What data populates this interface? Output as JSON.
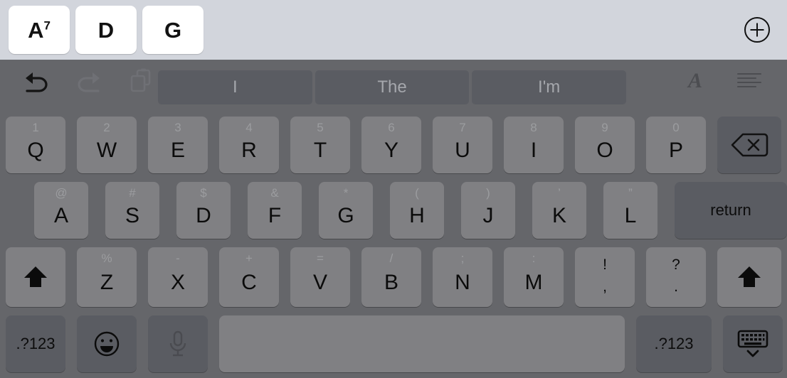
{
  "topbar": {
    "chords": [
      {
        "name": "chord-a7",
        "root": "A",
        "sup": "7"
      },
      {
        "name": "chord-d",
        "root": "D",
        "sup": ""
      },
      {
        "name": "chord-g",
        "root": "G",
        "sup": ""
      }
    ],
    "add_icon": "plus-circle-icon"
  },
  "toolbar": {
    "undo_icon": "undo-icon",
    "redo_icon": "redo-icon",
    "paste_icon": "paste-icon",
    "format_icon": "text-format-icon",
    "list_icon": "text-align-icon",
    "predictions": [
      "I",
      "The",
      "I'm"
    ]
  },
  "keyboard": {
    "row_numbers": [
      {
        "sec": "1",
        "main": "Q"
      },
      {
        "sec": "2",
        "main": "W"
      },
      {
        "sec": "3",
        "main": "E"
      },
      {
        "sec": "4",
        "main": "R"
      },
      {
        "sec": "5",
        "main": "T"
      },
      {
        "sec": "6",
        "main": "Y"
      },
      {
        "sec": "7",
        "main": "U"
      },
      {
        "sec": "8",
        "main": "I"
      },
      {
        "sec": "9",
        "main": "O"
      },
      {
        "sec": "0",
        "main": "P"
      }
    ],
    "backspace": {
      "name": "backspace-key",
      "icon": "backspace-icon"
    },
    "row_home": [
      {
        "sec": "@",
        "main": "A"
      },
      {
        "sec": "#",
        "main": "S"
      },
      {
        "sec": "$",
        "main": "D"
      },
      {
        "sec": "&",
        "main": "F"
      },
      {
        "sec": "*",
        "main": "G"
      },
      {
        "sec": "(",
        "main": "H"
      },
      {
        "sec": ")",
        "main": "J"
      },
      {
        "sec": "’",
        "main": "K"
      },
      {
        "sec": "”",
        "main": "L"
      }
    ],
    "return_key": {
      "label": "return"
    },
    "row_bottom": [
      {
        "sec": "%",
        "main": "Z"
      },
      {
        "sec": "-",
        "main": "X"
      },
      {
        "sec": "+",
        "main": "C"
      },
      {
        "sec": "=",
        "main": "V"
      },
      {
        "sec": "/",
        "main": "B"
      },
      {
        "sec": ";",
        "main": "N"
      },
      {
        "sec": ":",
        "main": "M"
      }
    ],
    "punct_keys": [
      {
        "sec": "!",
        "main": ","
      },
      {
        "sec": "?",
        "main": "."
      }
    ],
    "shift_left": {
      "name": "shift-key-left",
      "icon": "shift-icon"
    },
    "shift_right": {
      "name": "shift-key-right",
      "icon": "shift-icon"
    },
    "numeric_left": {
      "label": ".?123"
    },
    "numeric_right": {
      "label": ".?123"
    },
    "emoji_key": {
      "icon": "emoji-icon"
    },
    "dictation_key": {
      "icon": "microphone-icon"
    },
    "spacebar": {
      "label": ""
    },
    "dismiss_key": {
      "icon": "dismiss-keyboard-icon"
    }
  }
}
